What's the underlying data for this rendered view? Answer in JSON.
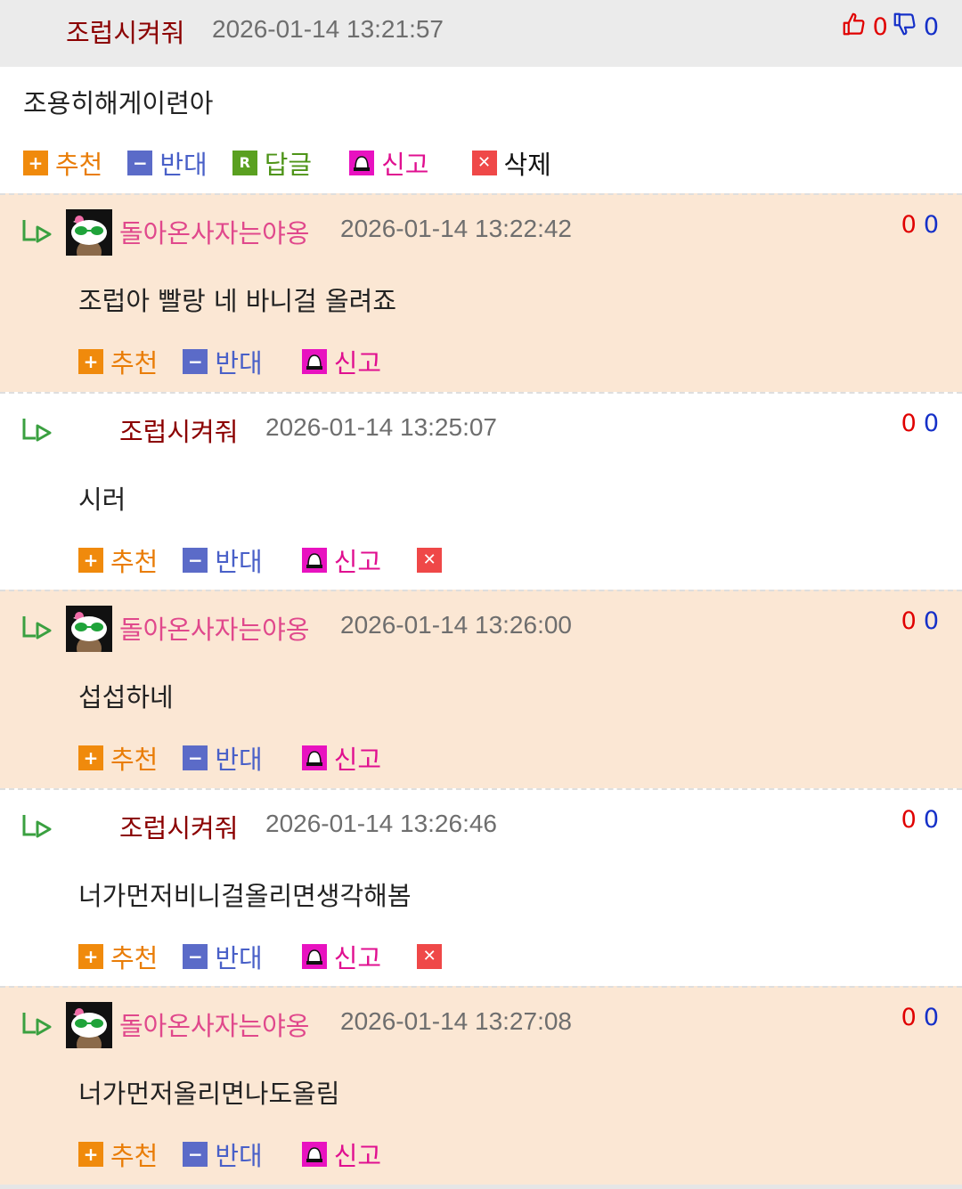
{
  "post": {
    "nickname": "조럽시켜줘",
    "date": "2026-01-14 13:21:57",
    "up_count": "0",
    "down_count": "0",
    "content": "조용히해게이련아",
    "actions": {
      "recommend": "추천",
      "oppose": "반대",
      "reply": "답글",
      "report": "신고",
      "delete": "삭제"
    }
  },
  "comments": [
    {
      "nickname": "돌아온사자는야옹",
      "date": "2026-01-14 13:22:42",
      "up": "0",
      "down": "0",
      "content": "조럽아 빨랑 네 바니걸 올려죠",
      "recommend": "추천",
      "oppose": "반대",
      "report": "신고"
    },
    {
      "nickname": "조럽시켜줘",
      "date": "2026-01-14 13:25:07",
      "up": "0",
      "down": "0",
      "content": "시러",
      "recommend": "추천",
      "oppose": "반대",
      "report": "신고"
    },
    {
      "nickname": "돌아온사자는야옹",
      "date": "2026-01-14 13:26:00",
      "up": "0",
      "down": "0",
      "content": "섭섭하네",
      "recommend": "추천",
      "oppose": "반대",
      "report": "신고"
    },
    {
      "nickname": "조럽시켜줘",
      "date": "2026-01-14 13:26:46",
      "up": "0",
      "down": "0",
      "content": "너가먼저비니걸올리면생각해봄",
      "recommend": "추천",
      "oppose": "반대",
      "report": "신고"
    },
    {
      "nickname": "돌아온사자는야옹",
      "date": "2026-01-14 13:27:08",
      "up": "0",
      "down": "0",
      "content": "너가먼저올리면나도올림",
      "recommend": "추천",
      "oppose": "반대",
      "report": "신고"
    }
  ],
  "icons": {
    "thumbs_up": "thumbs-up-icon",
    "thumbs_down": "thumbs-down-icon",
    "reply_arrow": "reply-arrow-icon",
    "plus": "plus-icon",
    "minus": "minus-icon",
    "reply": "reply-r-icon",
    "report": "siren-icon",
    "delete": "close-x-icon"
  },
  "colors": {
    "header_bg": "#ebebeb",
    "tinted_bg": "#fbe7d4",
    "nick_dark_red": "#8b0000",
    "nick_pink": "#e0488c",
    "recommend_orange": "#f08a0c",
    "oppose_blue": "#5b6bc8",
    "reply_green": "#5aa020",
    "report_magenta": "#e812c0",
    "delete_red": "#ef4848"
  }
}
